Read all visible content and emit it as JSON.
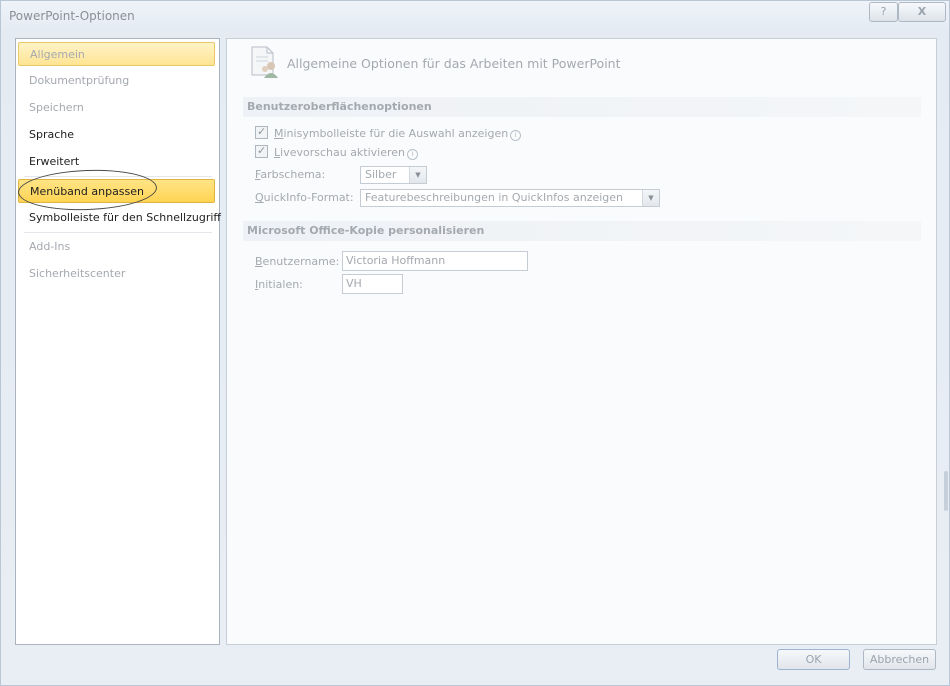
{
  "window": {
    "title": "PowerPoint-Optionen",
    "help_label": "?",
    "close_label": "X"
  },
  "sidebar": {
    "items": [
      {
        "label": "Allgemein"
      },
      {
        "label": "Dokumentprüfung"
      },
      {
        "label": "Speichern"
      },
      {
        "label": "Sprache"
      },
      {
        "label": "Erweitert"
      },
      {
        "label": "Menüband anpassen"
      },
      {
        "label": "Symbolleiste für den Schnellzugriff"
      },
      {
        "label": "Add-Ins"
      },
      {
        "label": "Sicherheitscenter"
      }
    ]
  },
  "main": {
    "header": "Allgemeine Optionen für das Arbeiten mit PowerPoint",
    "ui_section": {
      "title": "Benutzeroberflächenoptionen",
      "mini_toolbar": {
        "key": "M",
        "rest": "inisymbolleiste für die Auswahl anzeigen",
        "checked": true
      },
      "live_preview": {
        "key": "L",
        "rest": "ivevorschau aktivieren",
        "checked": true
      },
      "color_scheme": {
        "key": "F",
        "rest": "arbschema:",
        "value": "Silber"
      },
      "screentip": {
        "key": "Q",
        "rest": "uickInfo-Format:",
        "value": "Featurebeschreibungen in QuickInfos anzeigen"
      }
    },
    "personalize_section": {
      "title": "Microsoft Office-Kopie personalisieren",
      "username": {
        "key": "B",
        "rest": "enutzername:",
        "value": "Victoria Hoffmann"
      },
      "initials": {
        "key": "I",
        "rest": "nitialen:",
        "value": "VH"
      }
    }
  },
  "footer": {
    "ok_label": "OK",
    "cancel_label": "Abbrechen"
  },
  "icons": {
    "info": "i",
    "dropdown": "▼"
  }
}
